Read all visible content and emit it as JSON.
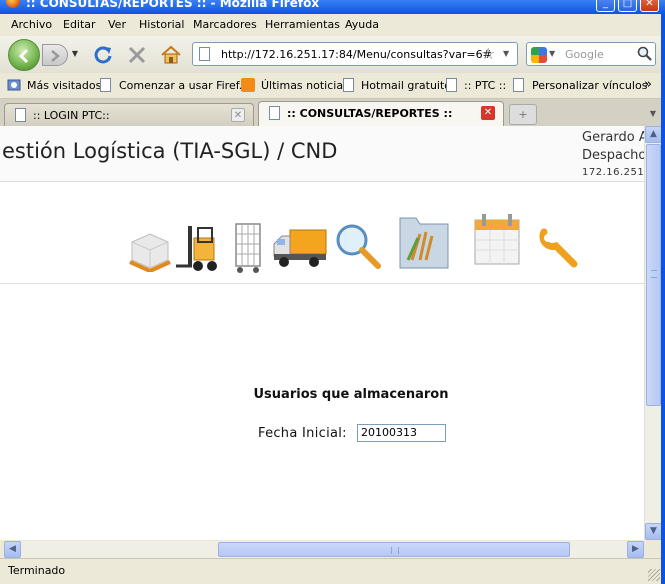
{
  "window": {
    "title": ":: CONSULTAS/REPORTES :: - Mozilla Firefox",
    "minimize_icon": "minimize-icon",
    "maximize_icon": "maximize-icon",
    "close_icon": "close-icon"
  },
  "menu": [
    "Archivo",
    "Editar",
    "Ver",
    "Historial",
    "Marcadores",
    "Herramientas",
    "Ayuda"
  ],
  "navbar": {
    "url": "http://172.16.251.17:84/Menu/consultas?var=6#",
    "search_placeholder": "Google",
    "icons": [
      "back-icon",
      "forward-icon",
      "reload-icon",
      "stop-icon",
      "home-icon",
      "bookmark-star-icon",
      "search-icon"
    ]
  },
  "bookmarks": [
    {
      "label": "Más visitados",
      "icon": "most-visited-icon"
    },
    {
      "label": "Comenzar a usar Firef...",
      "icon": "page-icon"
    },
    {
      "label": "Últimas noticias",
      "icon": "rss-icon"
    },
    {
      "label": "Hotmail gratuito",
      "icon": "page-icon"
    },
    {
      "label": ":: PTC ::",
      "icon": "page-icon"
    },
    {
      "label": "Personalizar vínculos",
      "icon": "page-icon"
    }
  ],
  "bookmarks_overflow": "»",
  "tabs": [
    {
      "label": ":: LOGIN PTC::",
      "active": false
    },
    {
      "label": ":: CONSULTAS/REPORTES ::",
      "active": true
    }
  ],
  "page": {
    "app_title": "estión Logística (TIA-SGL) / CND",
    "user_name": "Gerardo A",
    "user_role": "Despacho",
    "user_ip": "172.16.251",
    "modules": [
      "pallet-icon",
      "forklift-icon",
      "cage-cart-icon",
      "truck-icon",
      "magnifier-icon",
      "folder-icon",
      "calendar-icon",
      "wrench-icon"
    ],
    "section_title": "Usuarios que almacenaron",
    "date_label": "Fecha Inicial:",
    "date_value": "20100313"
  },
  "status": {
    "text": "Terminado"
  }
}
